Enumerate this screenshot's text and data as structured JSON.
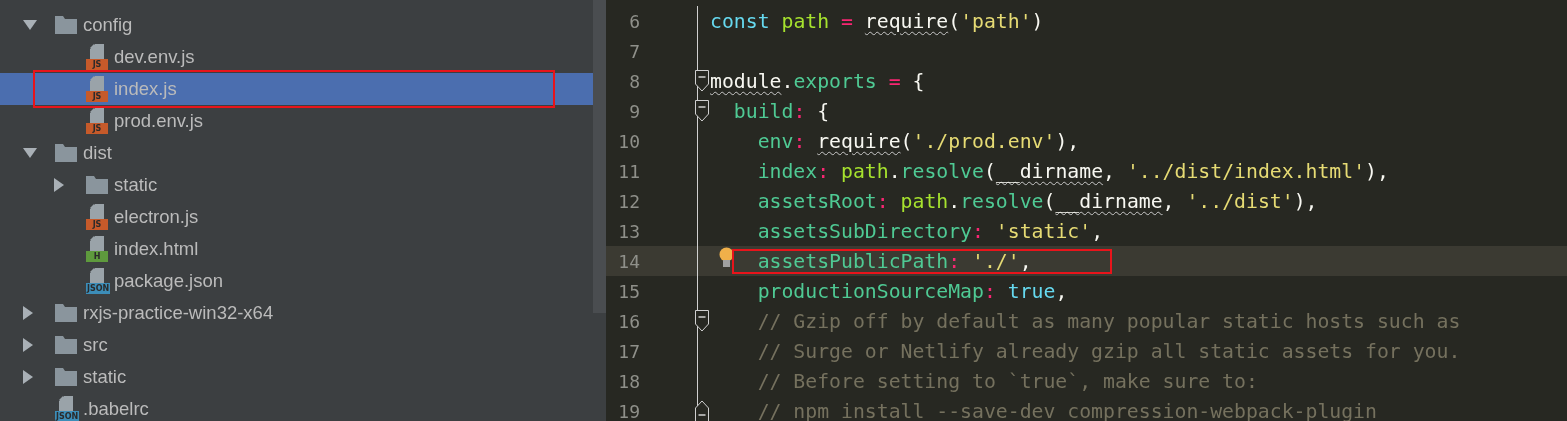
{
  "project_tree": {
    "items": [
      {
        "name": "config",
        "kind": "folder",
        "expanded": true,
        "selected": false,
        "children": [
          {
            "name": "dev.env.js",
            "kind": "file",
            "color": "#c65a2a",
            "badge": "JS",
            "selected": false,
            "outlined": false
          },
          {
            "name": "index.js",
            "kind": "file",
            "color": "#c65a2a",
            "badge": "JS",
            "selected": true,
            "outlined": true
          },
          {
            "name": "prod.env.js",
            "kind": "file",
            "color": "#c65a2a",
            "badge": "JS",
            "selected": false,
            "outlined": false
          }
        ]
      },
      {
        "name": "dist",
        "kind": "folder",
        "expanded": true,
        "selected": false,
        "children": [
          {
            "name": "static",
            "kind": "folder",
            "expanded": false,
            "selected": false
          },
          {
            "name": "electron.js",
            "kind": "file",
            "color": "#c65a2a",
            "badge": "JS",
            "selected": false,
            "outlined": false
          },
          {
            "name": "index.html",
            "kind": "file",
            "color": "#5e9a3d",
            "badge": "H",
            "selected": false,
            "outlined": false
          },
          {
            "name": "package.json",
            "kind": "file",
            "color": "#3c8db8",
            "badge": "JSON",
            "selected": false,
            "outlined": false
          }
        ]
      },
      {
        "name": "rxjs-practice-win32-x64",
        "kind": "folder",
        "expanded": false,
        "selected": false
      },
      {
        "name": "src",
        "kind": "folder",
        "expanded": false,
        "selected": false
      },
      {
        "name": "static",
        "kind": "folder",
        "expanded": false,
        "selected": false
      },
      {
        "name": ".babelrc",
        "kind": "file",
        "color": "#3c8db8",
        "badge": "JSON",
        "selected": false,
        "outlined": false
      }
    ]
  },
  "editor": {
    "lines": [
      {
        "number": "6",
        "current": false,
        "hint": false,
        "outlined": false,
        "fold_start": false,
        "fold_end": false,
        "tokens": [
          {
            "kind": "kw",
            "text": "const "
          },
          {
            "kind": "var",
            "text": "path "
          },
          {
            "kind": "op",
            "text": "= "
          },
          {
            "kind": "warn",
            "text": "require"
          },
          {
            "kind": "plain",
            "text": "("
          },
          {
            "kind": "str",
            "text": "'path'"
          },
          {
            "kind": "plain",
            "text": ")"
          }
        ]
      },
      {
        "number": "7",
        "current": false,
        "hint": false,
        "outlined": false,
        "fold_start": false,
        "fold_end": false
      },
      {
        "number": "8",
        "current": false,
        "hint": false,
        "outlined": false,
        "fold_start": true,
        "fold_end": false,
        "tokens": [
          {
            "kind": "warn",
            "text": "module"
          },
          {
            "kind": "plain",
            "text": "."
          },
          {
            "kind": "prop",
            "text": "exports "
          },
          {
            "kind": "op",
            "text": "= "
          },
          {
            "kind": "plain",
            "text": "{"
          }
        ]
      },
      {
        "number": "9",
        "current": false,
        "hint": false,
        "outlined": false,
        "fold_start": true,
        "fold_end": false,
        "tokens": [
          {
            "kind": "prop",
            "text": "  build"
          },
          {
            "kind": "op",
            "text": ": "
          },
          {
            "kind": "plain",
            "text": "{"
          }
        ]
      },
      {
        "number": "10",
        "current": false,
        "hint": false,
        "outlined": false,
        "fold_start": false,
        "fold_end": false,
        "tokens": [
          {
            "kind": "prop",
            "text": "    env"
          },
          {
            "kind": "op",
            "text": ": "
          },
          {
            "kind": "warn",
            "text": "require"
          },
          {
            "kind": "plain",
            "text": "("
          },
          {
            "kind": "str",
            "text": "'./prod.env'"
          },
          {
            "kind": "plain",
            "text": "),"
          }
        ]
      },
      {
        "number": "11",
        "current": false,
        "hint": false,
        "outlined": false,
        "fold_start": false,
        "fold_end": false,
        "tokens": [
          {
            "kind": "prop",
            "text": "    index"
          },
          {
            "kind": "op",
            "text": ": "
          },
          {
            "kind": "var",
            "text": "path"
          },
          {
            "kind": "plain",
            "text": "."
          },
          {
            "kind": "prop",
            "text": "resolve"
          },
          {
            "kind": "plain",
            "text": "("
          },
          {
            "kind": "warn",
            "text": "__dirname"
          },
          {
            "kind": "plain",
            "text": ", "
          },
          {
            "kind": "str",
            "text": "'../dist/index.html'"
          },
          {
            "kind": "plain",
            "text": "),"
          }
        ]
      },
      {
        "number": "12",
        "current": false,
        "hint": false,
        "outlined": false,
        "fold_start": false,
        "fold_end": false,
        "tokens": [
          {
            "kind": "prop",
            "text": "    assetsRoot"
          },
          {
            "kind": "op",
            "text": ": "
          },
          {
            "kind": "var",
            "text": "path"
          },
          {
            "kind": "plain",
            "text": "."
          },
          {
            "kind": "prop",
            "text": "resolve"
          },
          {
            "kind": "plain",
            "text": "("
          },
          {
            "kind": "warn",
            "text": "__dirname"
          },
          {
            "kind": "plain",
            "text": ", "
          },
          {
            "kind": "str",
            "text": "'../dist'"
          },
          {
            "kind": "plain",
            "text": "),"
          }
        ]
      },
      {
        "number": "13",
        "current": false,
        "hint": false,
        "outlined": false,
        "fold_start": false,
        "fold_end": false,
        "tokens": [
          {
            "kind": "prop",
            "text": "    assetsSubDirectory"
          },
          {
            "kind": "op",
            "text": ": "
          },
          {
            "kind": "str",
            "text": "'static'"
          },
          {
            "kind": "plain",
            "text": ","
          }
        ]
      },
      {
        "number": "14",
        "current": true,
        "hint": true,
        "outlined": true,
        "fold_start": false,
        "fold_end": false,
        "tokens": [
          {
            "kind": "prop",
            "text": "    assetsPublicPath"
          },
          {
            "kind": "op",
            "text": ": "
          },
          {
            "kind": "str",
            "text": "'./'"
          },
          {
            "kind": "plain",
            "text": ","
          }
        ]
      },
      {
        "number": "15",
        "current": false,
        "hint": false,
        "outlined": false,
        "fold_start": false,
        "fold_end": false,
        "tokens": [
          {
            "kind": "prop",
            "text": "    productionSourceMap"
          },
          {
            "kind": "op",
            "text": ": "
          },
          {
            "kind": "kw",
            "text": "true"
          },
          {
            "kind": "plain",
            "text": ","
          }
        ]
      },
      {
        "number": "16",
        "current": false,
        "hint": false,
        "outlined": false,
        "fold_start": true,
        "fold_end": false,
        "tokens": [
          {
            "kind": "comment",
            "text": "    // Gzip off by default as many popular static hosts such as"
          }
        ]
      },
      {
        "number": "17",
        "current": false,
        "hint": false,
        "outlined": false,
        "fold_start": false,
        "fold_end": false,
        "tokens": [
          {
            "kind": "comment",
            "text": "    // Surge or Netlify already gzip all static assets for you."
          }
        ]
      },
      {
        "number": "18",
        "current": false,
        "hint": false,
        "outlined": false,
        "fold_start": false,
        "fold_end": false,
        "tokens": [
          {
            "kind": "comment",
            "text": "    // Before setting to `true`, make sure to:"
          }
        ]
      },
      {
        "number": "19",
        "current": false,
        "hint": false,
        "outlined": false,
        "fold_start": false,
        "fold_end": true,
        "tokens": [
          {
            "kind": "comment",
            "text": "    // npm install --save-dev compression-webpack-plugin"
          }
        ]
      }
    ]
  }
}
